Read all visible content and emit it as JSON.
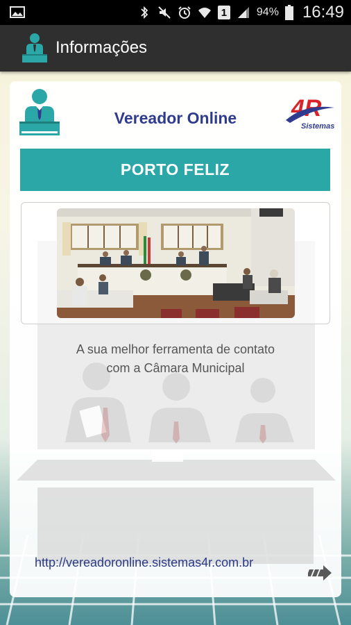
{
  "status_bar": {
    "battery": "94%",
    "time": "16:49",
    "sim": "1",
    "icons": [
      "gallery-icon",
      "bluetooth-icon",
      "mute-icon",
      "alarm-icon",
      "wifi-icon",
      "sim-icon",
      "signal-icon",
      "battery-icon"
    ]
  },
  "app_bar": {
    "title": "Informações",
    "icon": "councilman-icon"
  },
  "card": {
    "title": "Vereador Online",
    "brand": "4R Sistemas",
    "city": "PORTO FELIZ",
    "tagline_line1": "A sua melhor ferramenta de contato",
    "tagline_line2": "com a Câmara Municipal",
    "link": "http://vereadoronline.sistemas4r.com.br",
    "next_icon": "forward-arrow-icon"
  },
  "colors": {
    "accent": "#2aa7a6",
    "title_blue": "#2f3b8f",
    "app_bar": "#2f2f2f",
    "brand_red": "#d8232a"
  }
}
